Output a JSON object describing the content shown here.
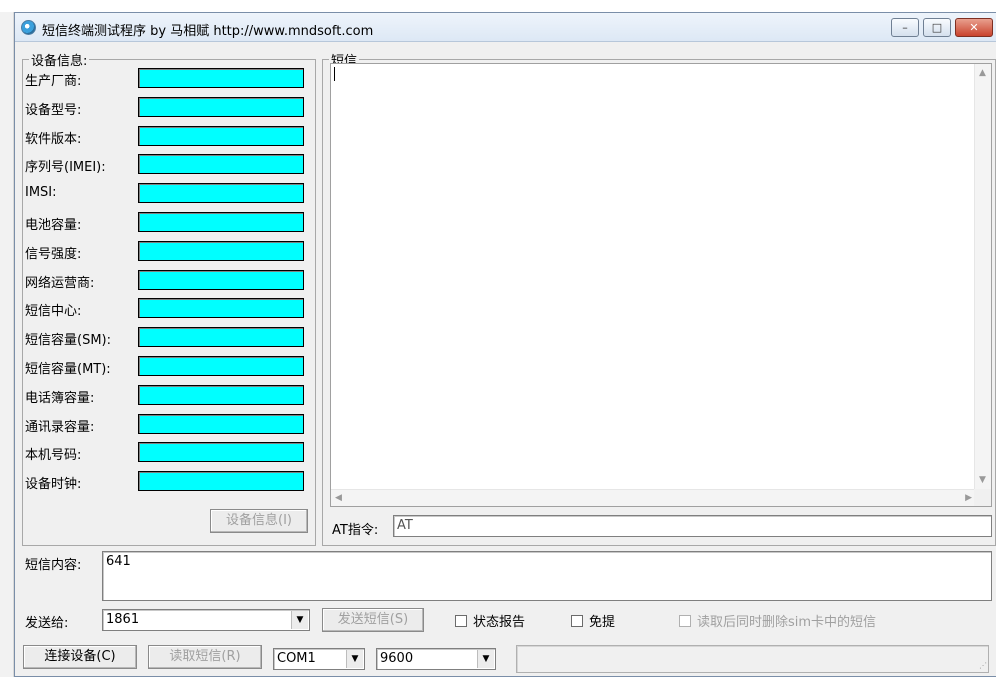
{
  "window": {
    "title": "短信终端测试程序  by 马相赋 http://www.mndsoft.com",
    "min_glyph": "–",
    "max_glyph": "□",
    "close_glyph": "✕"
  },
  "device_info": {
    "legend": "设备信息:",
    "fields": [
      {
        "label": "生产厂商:",
        "value": ""
      },
      {
        "label": "设备型号:",
        "value": ""
      },
      {
        "label": "软件版本:",
        "value": ""
      },
      {
        "label": "序列号(IMEI):",
        "value": ""
      },
      {
        "label": "IMSI:",
        "value": ""
      },
      {
        "label": "电池容量:",
        "value": ""
      },
      {
        "label": "信号强度:",
        "value": ""
      },
      {
        "label": "网络运营商:",
        "value": ""
      },
      {
        "label": "短信中心:",
        "value": ""
      },
      {
        "label": "短信容量(SM):",
        "value": ""
      },
      {
        "label": "短信容量(MT):",
        "value": ""
      },
      {
        "label": "电话簿容量:",
        "value": ""
      },
      {
        "label": "通讯录容量:",
        "value": ""
      },
      {
        "label": "本机号码:",
        "value": ""
      },
      {
        "label": "设备时钟:",
        "value": ""
      }
    ],
    "button_label": "设备信息(I)",
    "field_color": "#00ffff"
  },
  "sms_panel": {
    "legend": "短信",
    "content": "",
    "at_label": "AT指令:",
    "at_value": "AT"
  },
  "message": {
    "label": "短信内容:",
    "value": "641"
  },
  "send": {
    "label": "发送给:",
    "recipient": "1861",
    "send_button": "发送短信(S)",
    "status_report": "状态报告",
    "hands_free": "免提",
    "delete_after_read": "读取后同时删除sim卡中的短信"
  },
  "bottom": {
    "connect_button": "连接设备(C)",
    "read_button": "读取短信(R)",
    "port": "COM1",
    "baud": "9600",
    "status_text": ""
  },
  "icons": {
    "dropdown": "▼",
    "scroll_up": "▲",
    "scroll_down": "▼",
    "scroll_left": "◀",
    "scroll_right": "▶"
  }
}
